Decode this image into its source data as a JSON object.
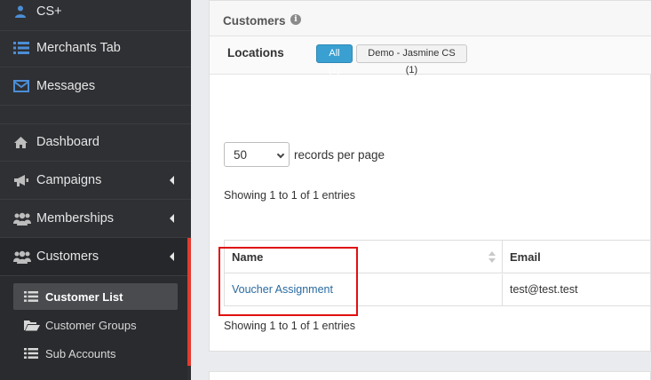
{
  "sidebar": {
    "top_items": [
      {
        "label": "CS+",
        "icon": "user-group-icon"
      },
      {
        "label": "Merchants Tab",
        "icon": "list-icon"
      },
      {
        "label": "Messages",
        "icon": "envelope-icon"
      }
    ],
    "items": [
      {
        "label": "Dashboard",
        "icon": "home-icon"
      },
      {
        "label": "Campaigns",
        "icon": "megaphone-icon"
      },
      {
        "label": "Memberships",
        "icon": "users-icon"
      },
      {
        "label": "Customers",
        "icon": "users-icon"
      }
    ],
    "sub_items": [
      {
        "label": "Customer List",
        "icon": "list-icon"
      },
      {
        "label": "Customer Groups",
        "icon": "folder-open-icon"
      },
      {
        "label": "Sub Accounts",
        "icon": "list-icon"
      }
    ]
  },
  "panel": {
    "title": "Customers",
    "locations_label": "Locations",
    "chips": [
      "All (1)",
      "Demo - Jasmine CS (1)"
    ],
    "page_size": "50",
    "records_per_page": "records per page",
    "info_top": "Showing 1 to 1 of 1 entries",
    "info_bottom": "Showing 1 to 1 of 1 entries",
    "table": {
      "headers": [
        "Name",
        "Email"
      ],
      "rows": [
        {
          "name": "Voucher Assignment",
          "email": "test@test.test"
        }
      ]
    }
  },
  "colors": {
    "sidebar_bg": "#2f3034",
    "accent_blue": "#3aa0d2",
    "active_marker": "#e23b2f",
    "link": "#2a6aa0",
    "highlight_box": "#e01010"
  }
}
